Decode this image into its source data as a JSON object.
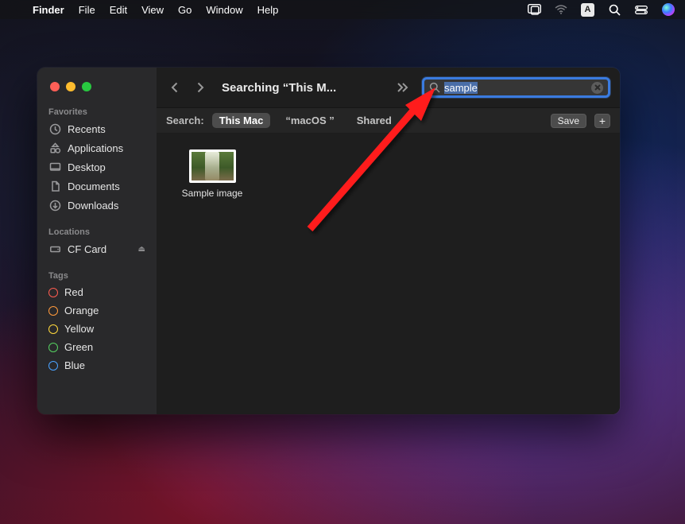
{
  "menubar": {
    "app_name": "Finder",
    "items": [
      "File",
      "Edit",
      "View",
      "Go",
      "Window",
      "Help"
    ],
    "input_badge": "A"
  },
  "window": {
    "title": "Searching “This M..."
  },
  "search": {
    "value": "sample"
  },
  "scope": {
    "label": "Search:",
    "items": [
      {
        "label": "This Mac",
        "active": true
      },
      {
        "label": "“macOS ”",
        "active": false
      },
      {
        "label": "Shared",
        "active": false
      }
    ],
    "save_label": "Save"
  },
  "sidebar": {
    "sections": [
      {
        "title": "Favorites",
        "items": [
          {
            "icon": "clock",
            "label": "Recents"
          },
          {
            "icon": "apps",
            "label": "Applications"
          },
          {
            "icon": "desktop",
            "label": "Desktop"
          },
          {
            "icon": "document",
            "label": "Documents"
          },
          {
            "icon": "download",
            "label": "Downloads"
          }
        ]
      },
      {
        "title": "Locations",
        "items": [
          {
            "icon": "drive",
            "label": "CF Card",
            "ejectable": true
          }
        ]
      },
      {
        "title": "Tags",
        "items": [
          {
            "tag_color": "#ff5c50",
            "label": "Red"
          },
          {
            "tag_color": "#ff9a3c",
            "label": "Orange"
          },
          {
            "tag_color": "#ffd93c",
            "label": "Yellow"
          },
          {
            "tag_color": "#55d160",
            "label": "Green"
          },
          {
            "tag_color": "#4aa3ff",
            "label": "Blue"
          }
        ]
      }
    ]
  },
  "results": [
    {
      "name": "Sample image"
    }
  ]
}
